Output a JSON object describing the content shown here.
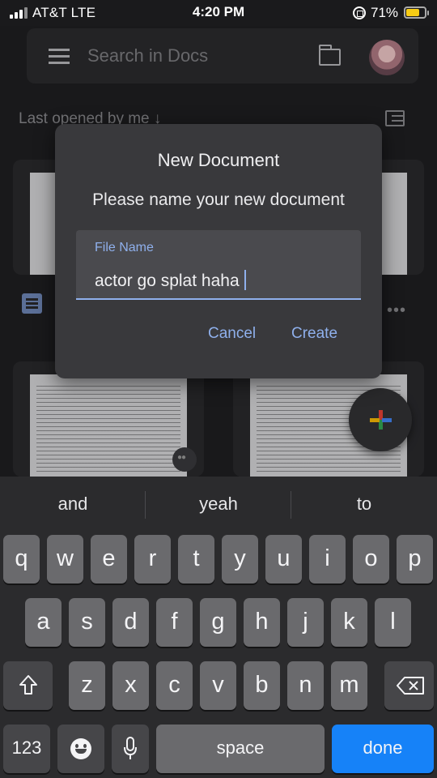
{
  "status_bar": {
    "carrier": "AT&T  LTE",
    "time": "4:20 PM",
    "battery_percent": "71%",
    "battery_level": 0.71,
    "battery_color": "#f7cc15"
  },
  "app": {
    "search_placeholder": "Search in Docs",
    "section_label": "Last opened by me ↓",
    "icons": [
      "hamburger-icon",
      "folder-icon",
      "avatar",
      "list-view-icon",
      "docs-icon",
      "more-icon",
      "shared-icon",
      "plus-icon"
    ]
  },
  "dialog": {
    "title": "New Document",
    "message": "Please name your new document",
    "field_label": "File Name",
    "field_value": "actor go splat haha",
    "cancel_label": "Cancel",
    "create_label": "Create",
    "accent_color": "#8fb0ec"
  },
  "keyboard": {
    "suggestions": [
      "and",
      "yeah",
      "to"
    ],
    "row1": [
      "q",
      "w",
      "e",
      "r",
      "t",
      "y",
      "u",
      "i",
      "o",
      "p"
    ],
    "row2": [
      "a",
      "s",
      "d",
      "f",
      "g",
      "h",
      "j",
      "k",
      "l"
    ],
    "row3": [
      "z",
      "x",
      "c",
      "v",
      "b",
      "n",
      "m"
    ],
    "numbers_label": "123",
    "space_label": "space",
    "done_label": "done",
    "done_color": "#1682f8"
  }
}
